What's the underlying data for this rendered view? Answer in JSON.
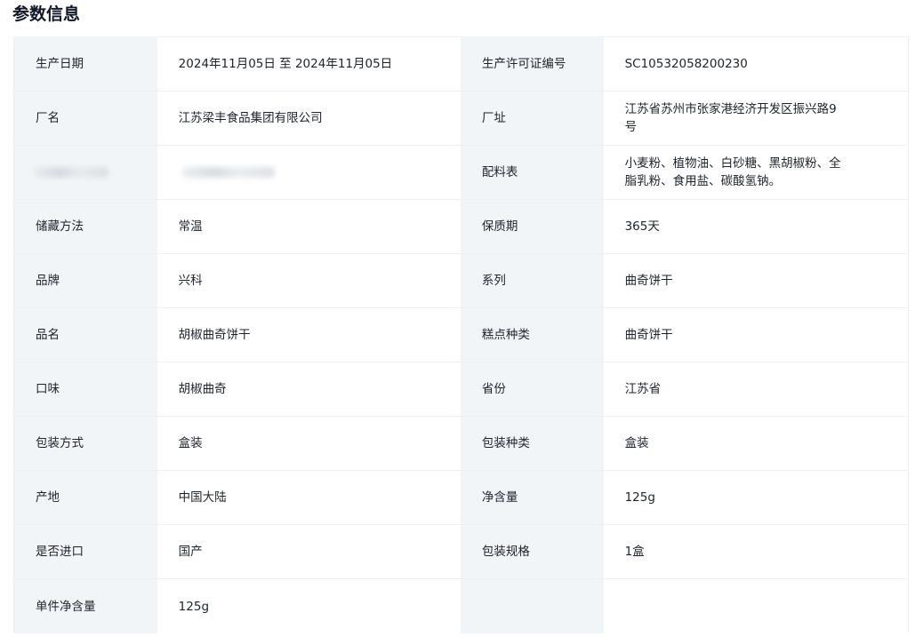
{
  "section": {
    "title": "参数信息"
  },
  "rows": [
    {
      "k1": "生产日期",
      "v1": "2024年11月05日 至 2024年11月05日",
      "k2": "生产许可证编号",
      "v2": "SC10532058200230"
    },
    {
      "k1": "厂名",
      "v1": "江苏梁丰食品集团有限公司",
      "k2": "厂址",
      "v2": "江苏省苏州市张家港经济开发区振兴路9号"
    },
    {
      "k1": "",
      "v1": "",
      "k2": "配料表",
      "v2": "小麦粉、植物油、白砂糖、黑胡椒粉、全脂乳粉、食用盐、碳酸氢钠。"
    },
    {
      "k1": "储藏方法",
      "v1": "常温",
      "k2": "保质期",
      "v2": "365天"
    },
    {
      "k1": "品牌",
      "v1": "兴科",
      "k2": "系列",
      "v2": "曲奇饼干"
    },
    {
      "k1": "品名",
      "v1": "胡椒曲奇饼干",
      "k2": "糕点种类",
      "v2": "曲奇饼干"
    },
    {
      "k1": "口味",
      "v1": "胡椒曲奇",
      "k2": "省份",
      "v2": "江苏省"
    },
    {
      "k1": "包装方式",
      "v1": "盒装",
      "k2": "包装种类",
      "v2": "盒装"
    },
    {
      "k1": "产地",
      "v1": "中国大陆",
      "k2": "净含量",
      "v2": "125g"
    },
    {
      "k1": "是否进口",
      "v1": "国产",
      "k2": "包装规格",
      "v2": "1盒"
    },
    {
      "k1": "单件净含量",
      "v1": "125g",
      "k2": "",
      "v2": ""
    }
  ]
}
